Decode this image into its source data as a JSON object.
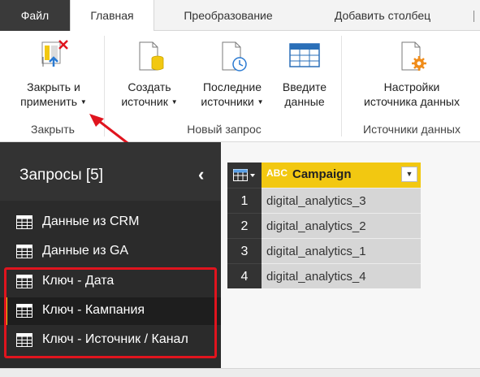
{
  "tabs": {
    "file": "Файл",
    "home": "Главная",
    "transform": "Преобразование",
    "add_column": "Добавить столбец"
  },
  "ribbon": {
    "close_apply": {
      "line1": "Закрыть и",
      "line2": "применить",
      "icon": "close-apply-icon"
    },
    "new_source": {
      "line1": "Создать",
      "line2": "источник",
      "icon": "new-source-icon"
    },
    "recent_sources": {
      "line1": "Последние",
      "line2": "источники",
      "icon": "recent-sources-icon"
    },
    "enter_data": {
      "line1": "Введите",
      "line2": "данные",
      "icon": "table-icon"
    },
    "source_settings": {
      "line1": "Настройки",
      "line2": "источника данных",
      "icon": "source-settings-icon"
    },
    "groups": {
      "close": "Закрыть",
      "new_query": "Новый запрос",
      "data_sources": "Источники данных"
    }
  },
  "queries": {
    "title": "Запросы [5]",
    "items": [
      {
        "label": "Данные из CRM",
        "selected": false
      },
      {
        "label": "Данные из GA",
        "selected": false
      },
      {
        "label": "Ключ - Дата",
        "selected": false
      },
      {
        "label": "Ключ - Кампания",
        "selected": true
      },
      {
        "label": "Ключ - Источник / Канал",
        "selected": false
      }
    ]
  },
  "grid": {
    "column_type": "ABC",
    "column_name": "Campaign",
    "rows": [
      {
        "num": "1",
        "value": "digital_analytics_3"
      },
      {
        "num": "2",
        "value": "digital_analytics_2"
      },
      {
        "num": "3",
        "value": "digital_analytics_1"
      },
      {
        "num": "4",
        "value": "digital_analytics_4"
      }
    ]
  },
  "colors": {
    "accent": "#f2c811",
    "highlight_box": "#e0141e",
    "pane_bg": "#2b2b2b"
  }
}
